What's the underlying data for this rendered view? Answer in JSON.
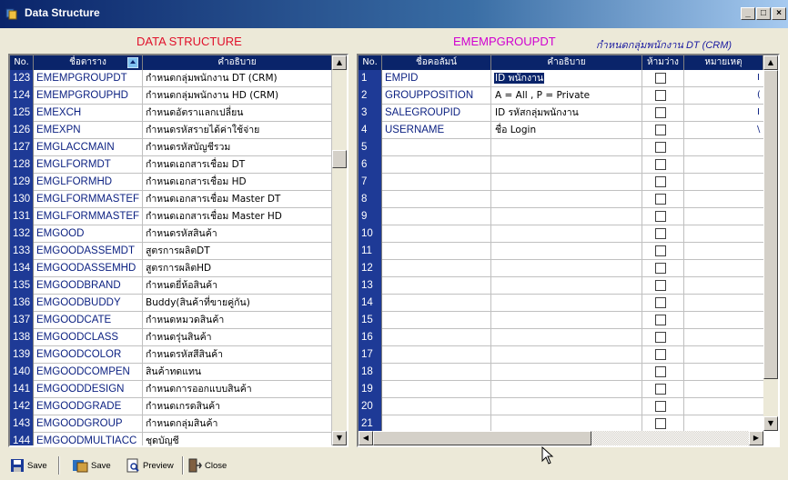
{
  "window": {
    "title": "Data Structure",
    "min": "_",
    "max": "□",
    "close": "×"
  },
  "left": {
    "heading": "DATA STRUCTURE",
    "columns": {
      "no": "No.",
      "table": "ชื่อตาราง",
      "desc": "คำอธิบาย"
    },
    "rows": [
      {
        "no": "123",
        "code": "EMEMPGROUPDT",
        "desc": "กำหนดกลุ่มพนักงาน DT (CRM)"
      },
      {
        "no": "124",
        "code": "EMEMPGROUPHD",
        "desc": "กำหนดกลุ่มพนักงาน HD (CRM)"
      },
      {
        "no": "125",
        "code": "EMEXCH",
        "desc": "กำหนดอัตราแลกเปลี่ยน"
      },
      {
        "no": "126",
        "code": "EMEXPN",
        "desc": "กำหนดรหัสรายได้ค่าใช้จ่าย"
      },
      {
        "no": "127",
        "code": "EMGLACCMAIN",
        "desc": "กำหนดรหัสบัญชีรวม"
      },
      {
        "no": "128",
        "code": "EMGLFORMDT",
        "desc": "กำหนดเอกสารเชื่อม DT"
      },
      {
        "no": "129",
        "code": "EMGLFORMHD",
        "desc": "กำหนดเอกสารเชื่อม HD"
      },
      {
        "no": "130",
        "code": "EMGLFORMMASTEF",
        "desc": "กำหนดเอกสารเชื่อม Master DT"
      },
      {
        "no": "131",
        "code": "EMGLFORMMASTEF",
        "desc": "กำหนดเอกสารเชื่อม Master HD"
      },
      {
        "no": "132",
        "code": "EMGOOD",
        "desc": "กำหนดรหัสสินค้า"
      },
      {
        "no": "133",
        "code": "EMGOODASSEMDT",
        "desc": "สูตรการผลิตDT"
      },
      {
        "no": "134",
        "code": "EMGOODASSEMHD",
        "desc": "สูตรการผลิตHD"
      },
      {
        "no": "135",
        "code": "EMGOODBRAND",
        "desc": "กำหนดยี่ห้อสินค้า"
      },
      {
        "no": "136",
        "code": "EMGOODBUDDY",
        "desc": "Buddy(สินค้าที่ขายคู่กัน)"
      },
      {
        "no": "137",
        "code": "EMGOODCATE",
        "desc": "กำหนดหมวดสินค้า"
      },
      {
        "no": "138",
        "code": "EMGOODCLASS",
        "desc": "กำหนดรุ่นสินค้า"
      },
      {
        "no": "139",
        "code": "EMGOODCOLOR",
        "desc": "กำหนดรหัสสีสินค้า"
      },
      {
        "no": "140",
        "code": "EMGOODCOMPEN",
        "desc": "สินค้าทดแทน"
      },
      {
        "no": "141",
        "code": "EMGOODDESIGN",
        "desc": "กำหนดการออกแบบสินค้า"
      },
      {
        "no": "142",
        "code": "EMGOODGRADE",
        "desc": "กำหนดเกรดสินค้า"
      },
      {
        "no": "143",
        "code": "EMGOODGROUP",
        "desc": "กำหนดกลุ่มสินค้า"
      },
      {
        "no": "144",
        "code": "EMGOODMULTIACC",
        "desc": "ชุดบัญชี"
      }
    ]
  },
  "right": {
    "heading": "EMEMPGROUPDT",
    "heading_desc": "กำหนดกลุ่มพนักงาน DT (CRM)",
    "columns": {
      "no": "No.",
      "field": "ชื่อคอลัมน์",
      "desc": "คำอธิบาย",
      "nullable": "ห้ามว่าง",
      "note": "หมายเหตุ"
    },
    "rows": [
      {
        "no": "1",
        "field": "EMPID",
        "desc": "ID พนักงาน"
      },
      {
        "no": "2",
        "field": "GROUPPOSITION",
        "desc": "A = All , P = Private"
      },
      {
        "no": "3",
        "field": "SALEGROUPID",
        "desc": "ID รหัสกลุ่มพนักงาน"
      },
      {
        "no": "4",
        "field": "USERNAME",
        "desc": "ชื่อ Login"
      },
      {
        "no": "5",
        "field": "",
        "desc": ""
      },
      {
        "no": "6",
        "field": "",
        "desc": ""
      },
      {
        "no": "7",
        "field": "",
        "desc": ""
      },
      {
        "no": "8",
        "field": "",
        "desc": ""
      },
      {
        "no": "9",
        "field": "",
        "desc": ""
      },
      {
        "no": "10",
        "field": "",
        "desc": ""
      },
      {
        "no": "11",
        "field": "",
        "desc": ""
      },
      {
        "no": "12",
        "field": "",
        "desc": ""
      },
      {
        "no": "13",
        "field": "",
        "desc": ""
      },
      {
        "no": "14",
        "field": "",
        "desc": ""
      },
      {
        "no": "15",
        "field": "",
        "desc": ""
      },
      {
        "no": "16",
        "field": "",
        "desc": ""
      },
      {
        "no": "17",
        "field": "",
        "desc": ""
      },
      {
        "no": "18",
        "field": "",
        "desc": ""
      },
      {
        "no": "19",
        "field": "",
        "desc": ""
      },
      {
        "no": "20",
        "field": "",
        "desc": ""
      },
      {
        "no": "21",
        "field": "",
        "desc": ""
      }
    ],
    "note_fragments": [
      "I",
      "(",
      "I",
      "\\"
    ]
  },
  "toolbar": {
    "save1": "Save",
    "save2": "Save",
    "preview": "Preview",
    "close": "Close"
  },
  "colors": {
    "heading_left": "#e0102a",
    "heading_right": "#d000d0",
    "heading_right_desc": "#1a1aa0",
    "grid_header": "#0a246a"
  }
}
